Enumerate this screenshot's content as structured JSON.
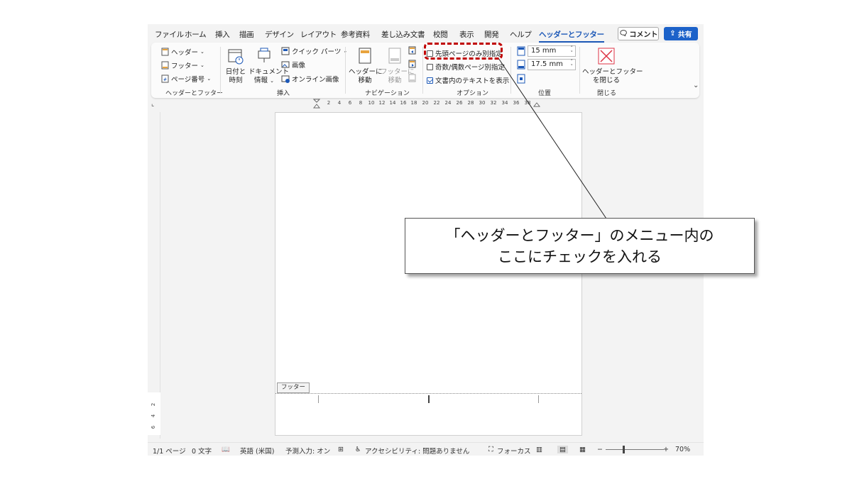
{
  "menu_tabs": [
    "ファイル",
    "ホーム",
    "挿入",
    "描画",
    "デザイン",
    "レイアウト",
    "参考資料",
    "差し込み文書",
    "校閲",
    "表示",
    "開発",
    "ヘルプ",
    "ヘッダーとフッター"
  ],
  "comment_label": "コメント",
  "share_label": "共有",
  "ribbon": {
    "hf_group": {
      "header": "ヘッダー",
      "footer": "フッター",
      "page_number": "ページ番号",
      "label": "ヘッダーとフッター"
    },
    "insert_group": {
      "date_time": [
        "日付と",
        "時刻"
      ],
      "doc_info": [
        "ドキュメント",
        "情報"
      ],
      "quick_parts": "クイック パーツ",
      "picture": "画像",
      "online_picture": "オンライン画像",
      "label": "挿入"
    },
    "nav_group": {
      "goto_header": [
        "ヘッダーに",
        "移動"
      ],
      "goto_footer": [
        "フッターに",
        "移動"
      ],
      "label": "ナビゲーション"
    },
    "options_group": {
      "first_page": "先頭ページのみ別指定",
      "odd_even": "奇数/偶数ページ別指定",
      "show_text": "文書内のテキストを表示",
      "first_page_checked": false,
      "odd_even_checked": false,
      "show_text_checked": true,
      "label": "オプション"
    },
    "position_group": {
      "header_from_top": "15 mm",
      "footer_from_bottom": "17.5 mm",
      "label": "位置"
    },
    "close_group": {
      "close": [
        "ヘッダーとフッター",
        "を閉じる"
      ],
      "label": "閉じる"
    }
  },
  "ruler_ticks": [
    "2",
    "4",
    "6",
    "8",
    "10",
    "12",
    "14",
    "16",
    "18",
    "20",
    "22",
    "24",
    "26",
    "28",
    "30",
    "32",
    "34",
    "36",
    "38"
  ],
  "vruler_ticks": [
    "2",
    "4",
    "6"
  ],
  "footer_tag": "フッター",
  "status": {
    "page": "1/1 ページ",
    "words": "0 文字",
    "language": "英語 (米国)",
    "predict": "予測入力: オン",
    "accessibility": "アクセシビリティ: 問題ありません",
    "focus": "フォーカス",
    "zoom": "70%"
  },
  "callout": {
    "line1": "「ヘッダーとフッター」のメニュー内の",
    "line2": "ここにチェックを入れる"
  },
  "colors": {
    "accent": "#1c58b7",
    "share": "#1c62c9",
    "highlight": "#c00000"
  }
}
